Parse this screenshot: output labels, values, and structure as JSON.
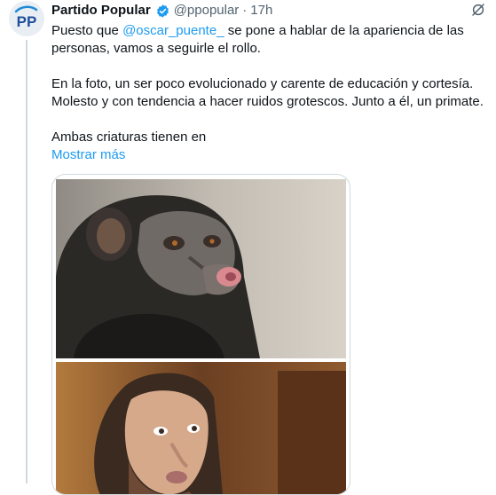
{
  "tweet": {
    "author_name": "Partido Popular",
    "author_handle": "@ppopular",
    "separator": "·",
    "time": "17h",
    "avatar_icon": "pp-logo-icon",
    "verified_icon": "verified-badge-icon",
    "more_icon": "grok-icon",
    "accent_color": "#1d9bf0",
    "paragraph1_before": "Puesto que ",
    "mention": "@oscar_puente_",
    "paragraph1_after": " se pone a hablar de la apariencia de las personas, vamos a seguirle el rollo.",
    "paragraph2": "En la foto, un ser poco evolucionado y carente de educación y cortesía. Molesto y con tendencia a hacer ruidos grotescos. Junto a él, un primate.",
    "paragraph3": "Ambas criaturas tienen en",
    "show_more": "Mostrar más"
  },
  "media": {
    "images": [
      "chimpanzee-photo",
      "man-photo"
    ]
  }
}
